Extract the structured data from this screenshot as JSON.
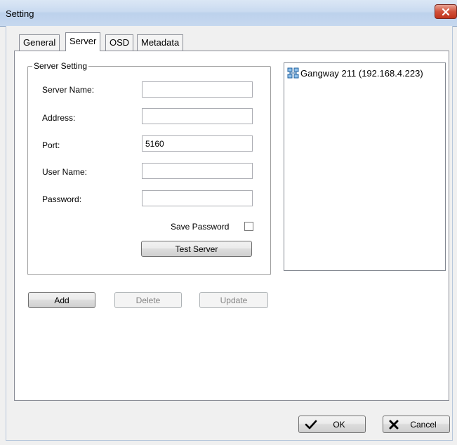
{
  "window": {
    "title": "Setting",
    "close_label": "×"
  },
  "tabs": [
    {
      "label": "General"
    },
    {
      "label": "Server"
    },
    {
      "label": "OSD"
    },
    {
      "label": "Metadata"
    }
  ],
  "server_setting": {
    "group_title": "Server Setting",
    "fields": {
      "server_name": {
        "label": "Server Name:",
        "value": ""
      },
      "address": {
        "label": "Address:",
        "value": ""
      },
      "port": {
        "label": "Port:",
        "value": "5160"
      },
      "user_name": {
        "label": "User Name:",
        "value": ""
      },
      "password": {
        "label": "Password:",
        "value": ""
      }
    },
    "save_password_label": "Save Password",
    "save_password_checked": false,
    "test_server_label": "Test Server"
  },
  "server_list": {
    "items": [
      {
        "label": "Gangway 211 (192.168.4.223)"
      }
    ]
  },
  "actions": {
    "add": "Add",
    "delete": "Delete",
    "update": "Update"
  },
  "dialog": {
    "ok": "OK",
    "cancel": "Cancel"
  }
}
